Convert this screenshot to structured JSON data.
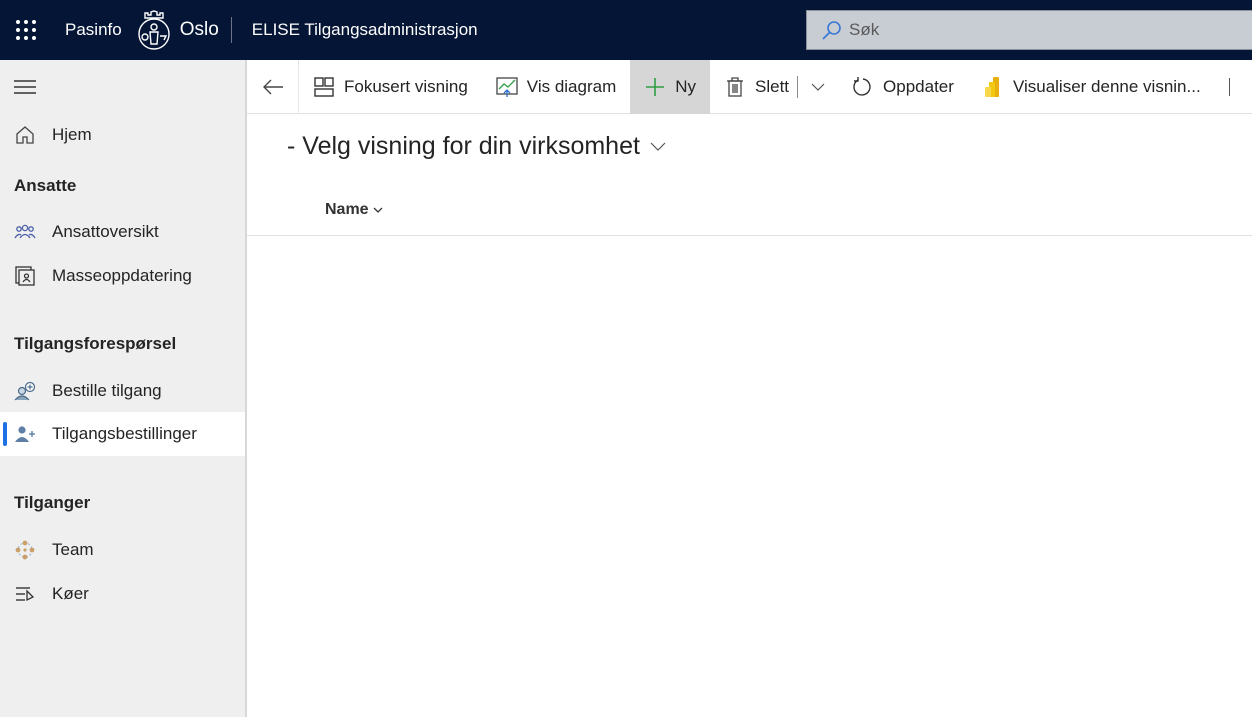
{
  "header": {
    "brand": "Pasinfo",
    "org": "Oslo",
    "app_title": "ELISE Tilgangsadministrasjon",
    "search": {
      "placeholder": "Søk",
      "value": ""
    }
  },
  "sidebar": {
    "items": [
      {
        "label": "Hjem",
        "icon": "home-icon"
      },
      {
        "label": "Ansattoversikt",
        "icon": "people-icon"
      },
      {
        "label": "Masseoppdatering",
        "icon": "contact-card-icon"
      },
      {
        "label": "Bestille tilgang",
        "icon": "person-add-circle-icon"
      },
      {
        "label": "Tilgangsbestillinger",
        "icon": "person-add-icon",
        "active": true
      },
      {
        "label": "Team",
        "icon": "team-icon"
      },
      {
        "label": "Køer",
        "icon": "queue-icon"
      }
    ],
    "sections": [
      "Ansatte",
      "Tilgangsforespørsel",
      "Tilganger"
    ],
    "active_accent": "#1f6fe5"
  },
  "commandbar": {
    "items": [
      {
        "label": "Fokusert visning",
        "icon": "focused-view-icon"
      },
      {
        "label": "Vis diagram",
        "icon": "chart-icon"
      },
      {
        "label": "Ny",
        "icon": "plus-icon"
      },
      {
        "label": "Slett",
        "icon": "trash-icon"
      },
      {
        "label": "Oppdater",
        "icon": "refresh-icon"
      },
      {
        "label": "Visualiser denne visnin...",
        "icon": "power-bi-icon"
      }
    ]
  },
  "main": {
    "view_title": "- Velg visning for din virksomhet",
    "columns": [
      {
        "label": "Name"
      }
    ]
  },
  "colors": {
    "topbar": "#041536",
    "sidebar_bg": "#efefef",
    "new_icon": "#2f9e44"
  }
}
